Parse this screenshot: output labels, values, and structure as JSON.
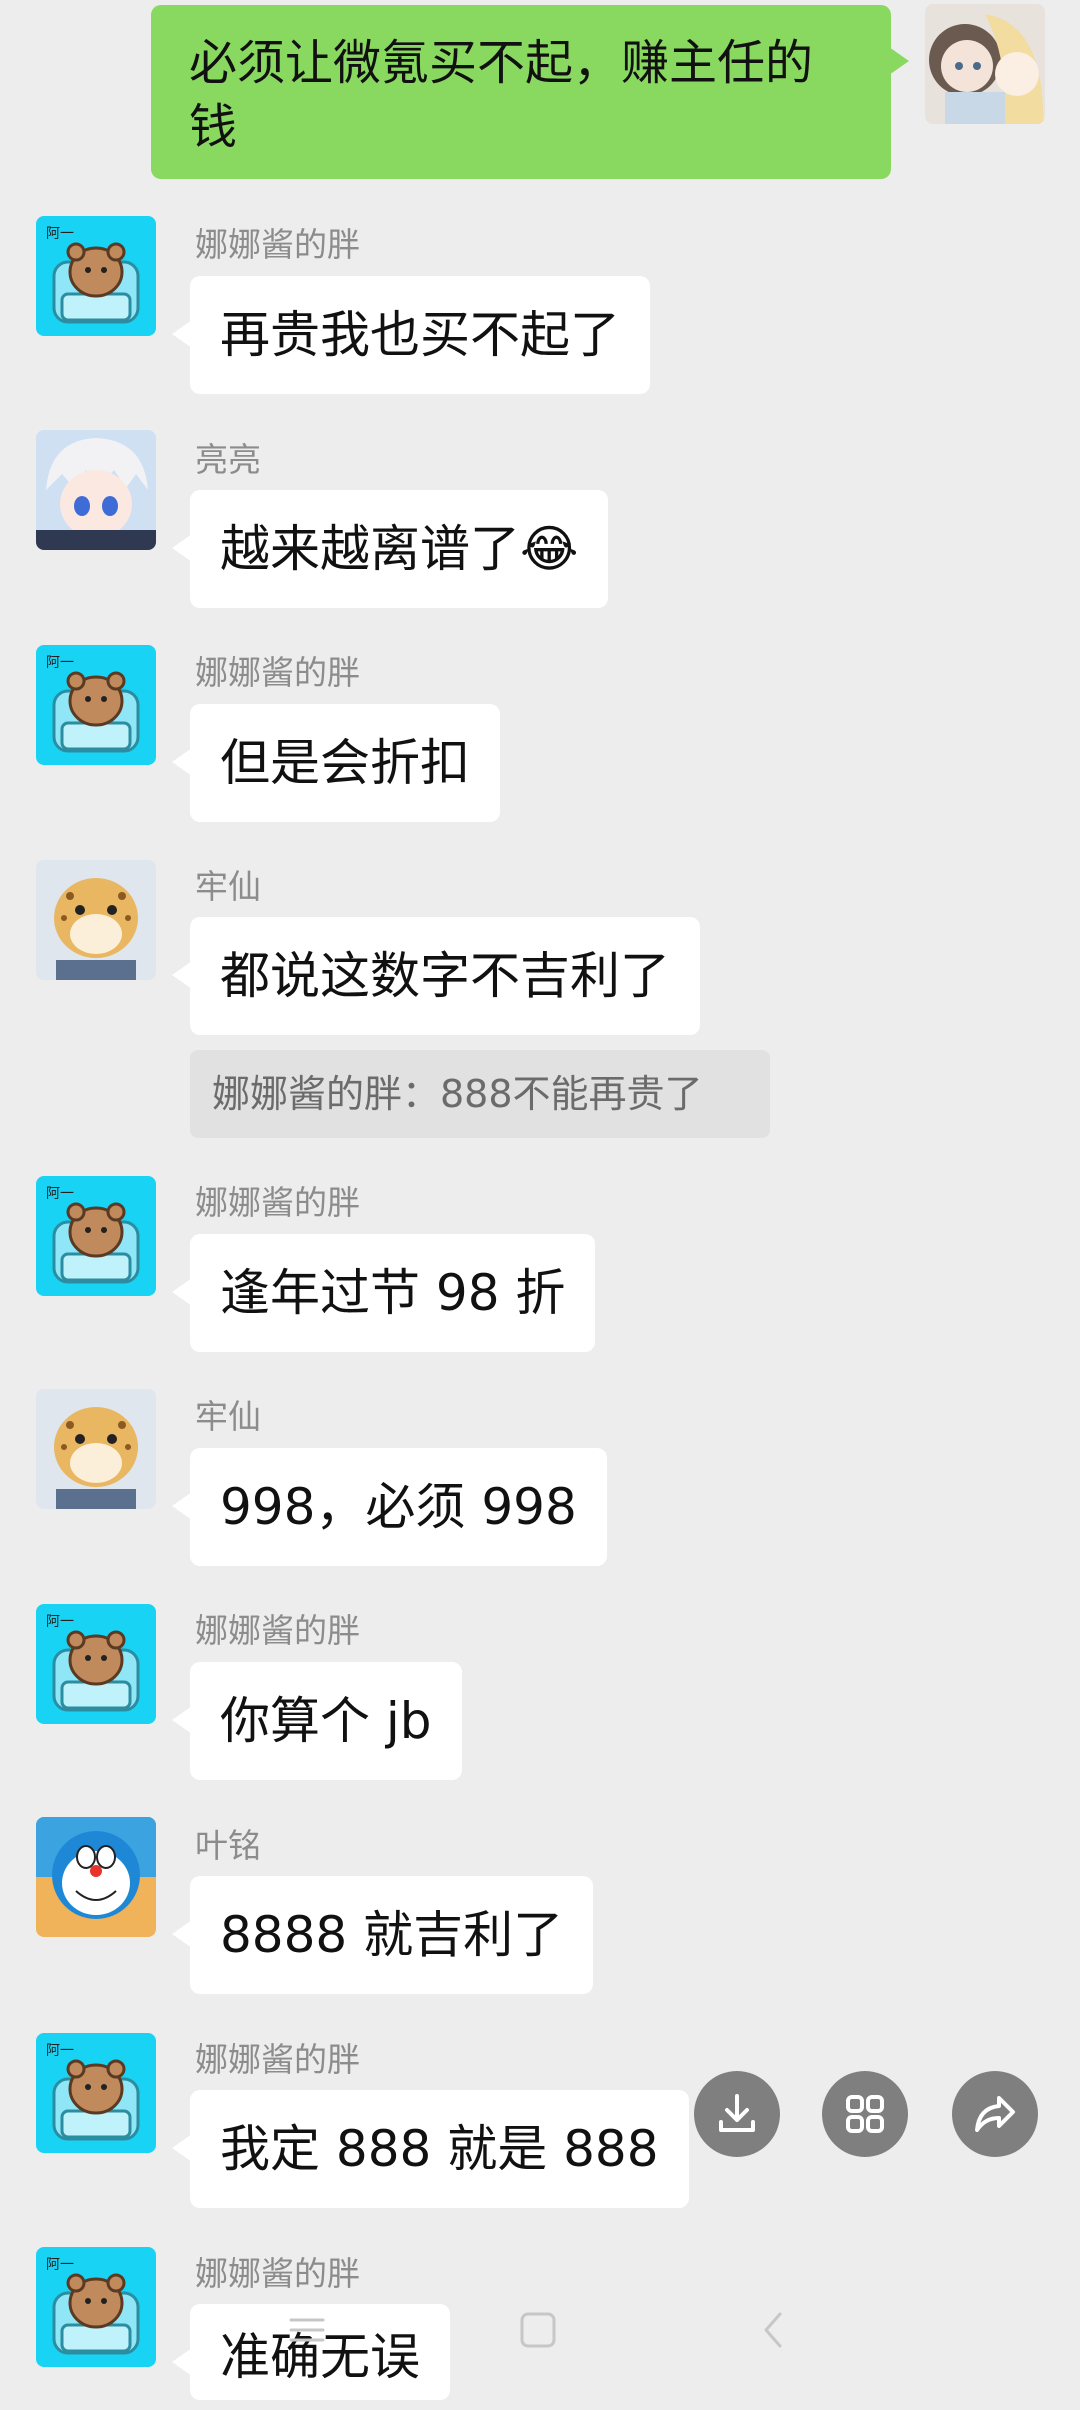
{
  "own_message": {
    "text": "必须让微氪买不起，赚主任的钱"
  },
  "messages": [
    {
      "sender": "娜娜酱的胖",
      "text": "再贵我也买不起了",
      "avatar": "bear-sofa-avatar"
    },
    {
      "sender": "亮亮",
      "text": "越来越离谱了",
      "emoji": "😂",
      "avatar": "anime-boy-avatar"
    },
    {
      "sender": "娜娜酱的胖",
      "text": "但是会折扣",
      "avatar": "bear-sofa-avatar"
    },
    {
      "sender": "牢仙",
      "text": "都说这数字不吉利了",
      "avatar": "cheetah-avatar"
    },
    {
      "sender": "娜娜酱的胖",
      "text": "逢年过节 98 折",
      "avatar": "bear-sofa-avatar"
    },
    {
      "sender": "牢仙",
      "text": "998，必须 998",
      "avatar": "cheetah-avatar"
    },
    {
      "sender": "娜娜酱的胖",
      "text": "你算个 jb",
      "avatar": "bear-sofa-avatar"
    },
    {
      "sender": "叶铭",
      "text": "8888 就吉利了",
      "avatar": "doraemon-avatar"
    },
    {
      "sender": "娜娜酱的胖",
      "text": "我定 888 就是 888",
      "avatar": "bear-sofa-avatar"
    },
    {
      "sender": "娜娜酱的胖",
      "text": "准确无误",
      "avatar": "bear-sofa-avatar"
    }
  ],
  "quote": {
    "text": "娜娜酱的胖：888不能再贵了"
  },
  "avatar_badge": "阿一",
  "actions": [
    "download-icon",
    "grid-icon",
    "share-icon"
  ],
  "nav": [
    "menu-icon",
    "home-square-icon",
    "back-chevron-icon"
  ],
  "colors": {
    "background": "#ededed",
    "own_bubble": "#89d961",
    "bubble": "#ffffff",
    "sender": "#8c8c8c",
    "avatar_bear_bg": "#19d3f5"
  }
}
